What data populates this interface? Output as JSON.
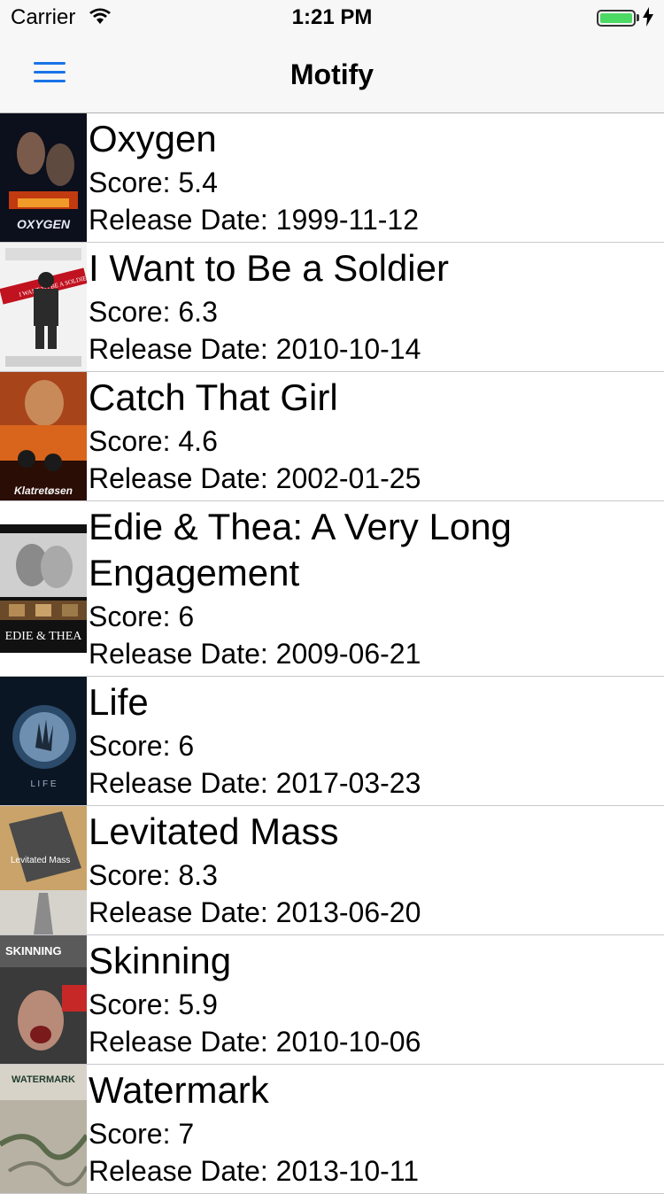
{
  "status": {
    "carrier": "Carrier",
    "time": "1:21 PM",
    "battery_level": 1.0
  },
  "nav": {
    "title": "Motify",
    "menu_icon": "hamburger-icon"
  },
  "movies": [
    {
      "title": "Oxygen",
      "score": "Score: 5.4",
      "release": "Release Date: 1999-11-12",
      "poster_text": "OXYGEN"
    },
    {
      "title": "I Want to Be a Soldier",
      "score": "Score: 6.3",
      "release": "Release Date: 2010-10-14",
      "poster_text": "I WANT TO BE A SOLDIER"
    },
    {
      "title": "Catch That Girl",
      "score": "Score: 4.6",
      "release": "Release Date: 2002-01-25",
      "poster_text": "Klatretøsen"
    },
    {
      "title": "Edie & Thea: A Very Long Engagement",
      "score": "Score: 6",
      "release": "Release Date: 2009-06-21",
      "poster_text": "EDIE & THEA"
    },
    {
      "title": "Life",
      "score": "Score: 6",
      "release": "Release Date: 2017-03-23",
      "poster_text": "L I F E"
    },
    {
      "title": "Levitated Mass",
      "score": "Score: 8.3",
      "release": "Release Date: 2013-06-20",
      "poster_text": "Levitated Mass"
    },
    {
      "title": "Skinning",
      "score": "Score: 5.9",
      "release": "Release Date: 2010-10-06",
      "poster_text": "SKINNING"
    },
    {
      "title": "Watermark",
      "score": "Score: 7",
      "release": "Release Date: 2013-10-11",
      "poster_text": "WATERMARK"
    }
  ]
}
